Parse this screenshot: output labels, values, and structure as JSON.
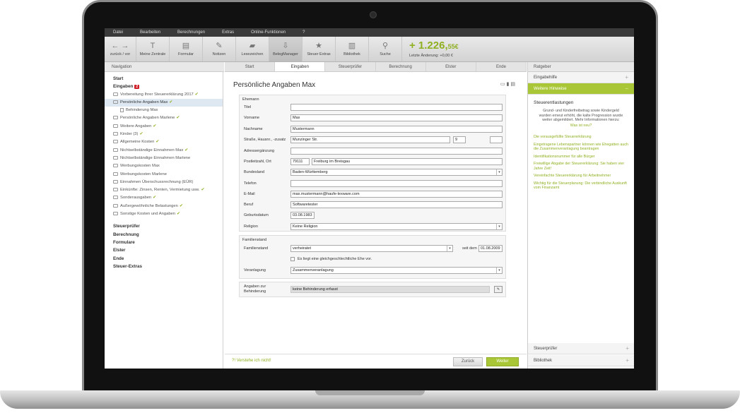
{
  "menu": [
    "Datei",
    "Bearbeiten",
    "Berechnungen",
    "Extras",
    "Online-Funktionen",
    "?"
  ],
  "toolbar": {
    "nav_label": "zurück / vor",
    "items": [
      {
        "label": "Meine Zentrale",
        "icon": "T"
      },
      {
        "label": "Formular",
        "icon": "▤"
      },
      {
        "label": "Notizen",
        "icon": "✎"
      },
      {
        "label": "Lesezeichen",
        "icon": "▰"
      },
      {
        "label": "BelegManager",
        "icon": "⇩"
      },
      {
        "label": "Steuer Extras",
        "icon": "★"
      },
      {
        "label": "Bibliothek",
        "icon": "▥"
      },
      {
        "label": "Suche",
        "icon": "⚲"
      }
    ],
    "amount_main": "+ 1.226,",
    "amount_cents": "55€",
    "last_change": "Letzte Änderung: +0,00 €"
  },
  "nav": {
    "header": "Navigation",
    "start": "Start",
    "eingaben": "Eingaben",
    "eingaben_badge": "2",
    "items": [
      {
        "label": "Vorbereitung Ihrer Steuererklärung 2017",
        "check": true
      },
      {
        "label": "Persönliche Angaben Max",
        "check": true
      },
      {
        "label": "Behinderung Max",
        "check": false
      },
      {
        "label": "Persönliche Angaben Marlene",
        "check": true
      },
      {
        "label": "Weitere Angaben",
        "check": true
      },
      {
        "label": "Kinder (3)",
        "check": true
      },
      {
        "label": "Allgemeine Kosten",
        "check": true
      },
      {
        "label": "Nichtselbständige Einnahmen Max",
        "check": true
      },
      {
        "label": "Nichtselbständige Einnahmen Marlene",
        "check": false
      },
      {
        "label": "Werbungskosten Max",
        "check": false
      },
      {
        "label": "Werbungskosten Marlene",
        "check": false
      },
      {
        "label": "Einnahmen Überschussrechnung (EÜR)",
        "check": false
      },
      {
        "label": "Einkünfte: Zinsen, Renten, Vermietung usw.",
        "check": true
      },
      {
        "label": "Sonderausgaben",
        "check": true
      },
      {
        "label": "Außergewöhnliche Belastungen",
        "check": true
      },
      {
        "label": "Sonstige Kosten und Angaben",
        "check": true
      }
    ],
    "sections": [
      "Steuerprüfer",
      "Berechnung",
      "Formulare",
      "Elster",
      "Ende",
      "Steuer-Extras"
    ]
  },
  "tabs": [
    "Start",
    "Eingaben",
    "Steuerprüfer",
    "Berechnung",
    "Elster",
    "Ende"
  ],
  "form": {
    "title": "Persönliche Angaben Max",
    "sec1_title": "Ehemann",
    "titel_label": "Titel",
    "titel": "",
    "vorname_label": "Vorname",
    "vorname": "Max",
    "nachname_label": "Nachname",
    "nachname": "Mustermann",
    "strasse_label": "Straße, Hausnr., -zusatz",
    "strasse": "Munzinger Str.",
    "hausnr": "9",
    "zusatz": "",
    "adress_label": "Adressergänzung",
    "adress": "",
    "plz_label": "Postleitzahl, Ort",
    "plz": "79111",
    "ort": "Freiburg im Breisgau",
    "bundesland_label": "Bundesland",
    "bundesland": "Baden-Württemberg",
    "telefon_label": "Telefon",
    "telefon": "",
    "email_label": "E-Mail",
    "email": "max.mustermann@haufe-lexware.com",
    "beruf_label": "Beruf",
    "beruf": "Softwaretester",
    "geburt_label": "Geburtsdatum",
    "geburt": "03.08.1983",
    "religion_label": "Religion",
    "religion": "Keine Religion",
    "sec2_title": "Familienstand",
    "familienstand_label": "Familienstand",
    "familienstand": "verheiratet",
    "seit_label": "seit dem",
    "seit": "01.08.2009",
    "ehe_checkbox": "Es liegt eine gleichgeschlechtliche Ehe vor.",
    "veranlagung_label": "Veranlagung",
    "veranlagung": "Zusammenveranlagung",
    "behinderung_label1": "Angaben zur",
    "behinderung_label2": "Behinderung",
    "behinderung": "keine Behinderung erfasst"
  },
  "footer": {
    "help": "Verstehe ich nicht!",
    "back": "Zurück",
    "next": "Weiter"
  },
  "ratgeber": {
    "header": "Ratgeber",
    "eingabehilfe": "Eingabehilfe",
    "weitere": "Weitere Hinweise",
    "title": "Steuerentlastungen",
    "text": "Grund- und Kinderfreibetrag sowie Kindergeld wurden erneut erhöht, die kalte Progression wurde weiter abgemildert. Mehr Informationen hierzu:",
    "text_link": "Was ist neu?",
    "links": [
      "Die vorausgefüllte Steuererklärung",
      "Eingetragene Lebenspartner können wie Ehegatten auch die Zusammenveranlagung beantragen",
      "Identifikationsnummer für alle Bürger",
      "Freiwillige Abgabe der Steuererklärung: Sie haben vier Jahre Zeit!",
      "Vereinfachte Steuererklärung für Arbeitnehmer",
      "Wichtig für die Steuerplanung: Die verbindliche Auskunft vom Finanzamt"
    ],
    "steuerpruefer": "Steuerprüfer",
    "bibliothek": "Bibliothek"
  }
}
